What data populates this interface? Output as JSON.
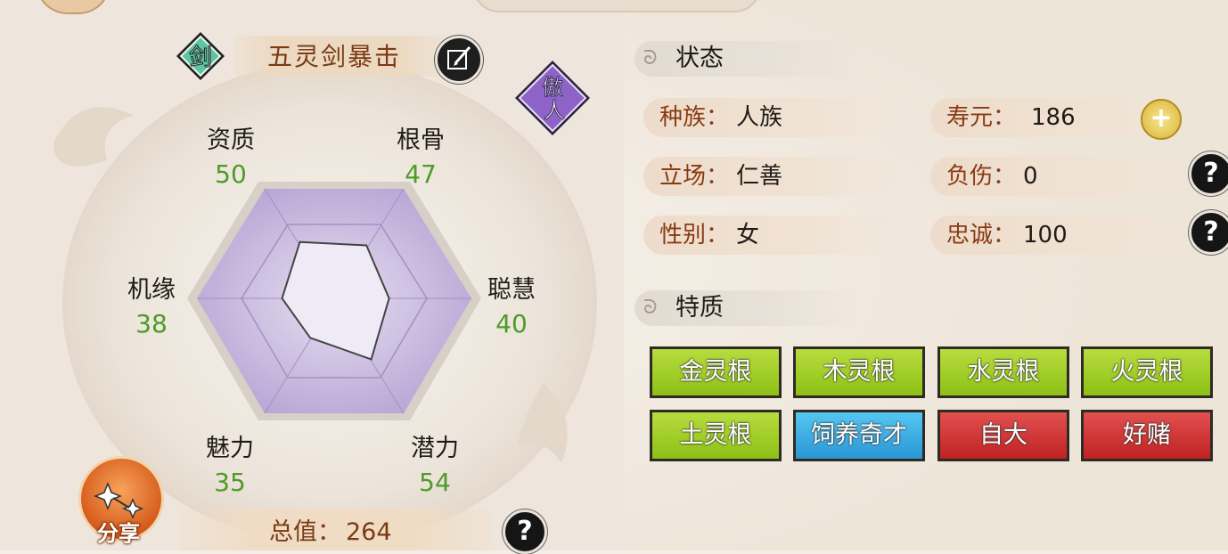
{
  "skill": {
    "badge_glyph": "剑",
    "name": "五灵剑暴击",
    "proud_glyph_1": "傲",
    "proud_glyph_2": "人"
  },
  "stats": {
    "zizhi": {
      "label": "资质",
      "value": "50"
    },
    "gengu": {
      "label": "根骨",
      "value": "47"
    },
    "conghui": {
      "label": "聪慧",
      "value": "40"
    },
    "qianli": {
      "label": "潜力",
      "value": "54"
    },
    "meili": {
      "label": "魅力",
      "value": "35"
    },
    "jiyuan": {
      "label": "机缘",
      "value": "38"
    }
  },
  "total": {
    "label": "总值：",
    "value": "264"
  },
  "share": {
    "label": "分享"
  },
  "status": {
    "title": "状态",
    "race": {
      "key": "种族：",
      "value": "人族"
    },
    "lifespan": {
      "key": "寿元：",
      "value": "186"
    },
    "stance": {
      "key": "立场：",
      "value": "仁善"
    },
    "injury": {
      "key": "负伤：",
      "value": "0"
    },
    "gender": {
      "key": "性别：",
      "value": "女"
    },
    "loyalty": {
      "key": "忠诚：",
      "value": "100"
    }
  },
  "traits": {
    "title": "特质",
    "items": [
      {
        "label": "金灵根",
        "color": "green"
      },
      {
        "label": "木灵根",
        "color": "green"
      },
      {
        "label": "水灵根",
        "color": "green"
      },
      {
        "label": "火灵根",
        "color": "green"
      },
      {
        "label": "土灵根",
        "color": "green"
      },
      {
        "label": "饲养奇才",
        "color": "blue"
      },
      {
        "label": "自大",
        "color": "red"
      },
      {
        "label": "好赌",
        "color": "red"
      }
    ]
  },
  "icons": {
    "help": "?",
    "plus": "+",
    "swirl": "ᘐ"
  },
  "colors": {
    "stat_value": "#4e9a2a",
    "key_text": "#8a3a12",
    "trait_green": "#9ccc20",
    "trait_blue": "#2fa4de",
    "trait_red": "#d23030"
  }
}
